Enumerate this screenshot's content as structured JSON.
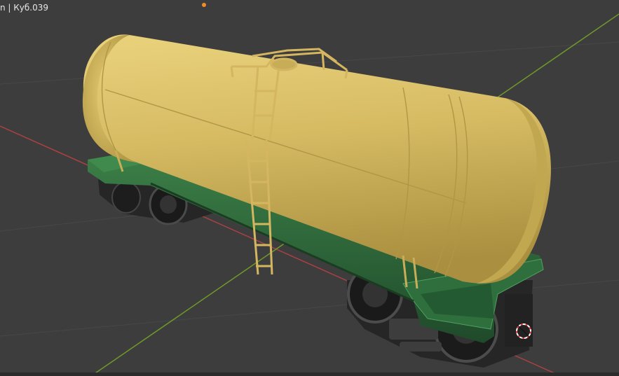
{
  "viewport": {
    "object_info": "n | Куб.039",
    "background_color": "#3d3d3d",
    "x_axis_color": "#a84242",
    "y_axis_color": "#6f9a2a",
    "grid_color": "#474747",
    "origin_color": "#f08c2c",
    "cursor_color": "#e04040"
  },
  "model": {
    "tank_color": "#d8bd68",
    "frame_color": "#2e6b3c",
    "bogie_color": "#262626",
    "ladder_color": "#d4b660"
  }
}
